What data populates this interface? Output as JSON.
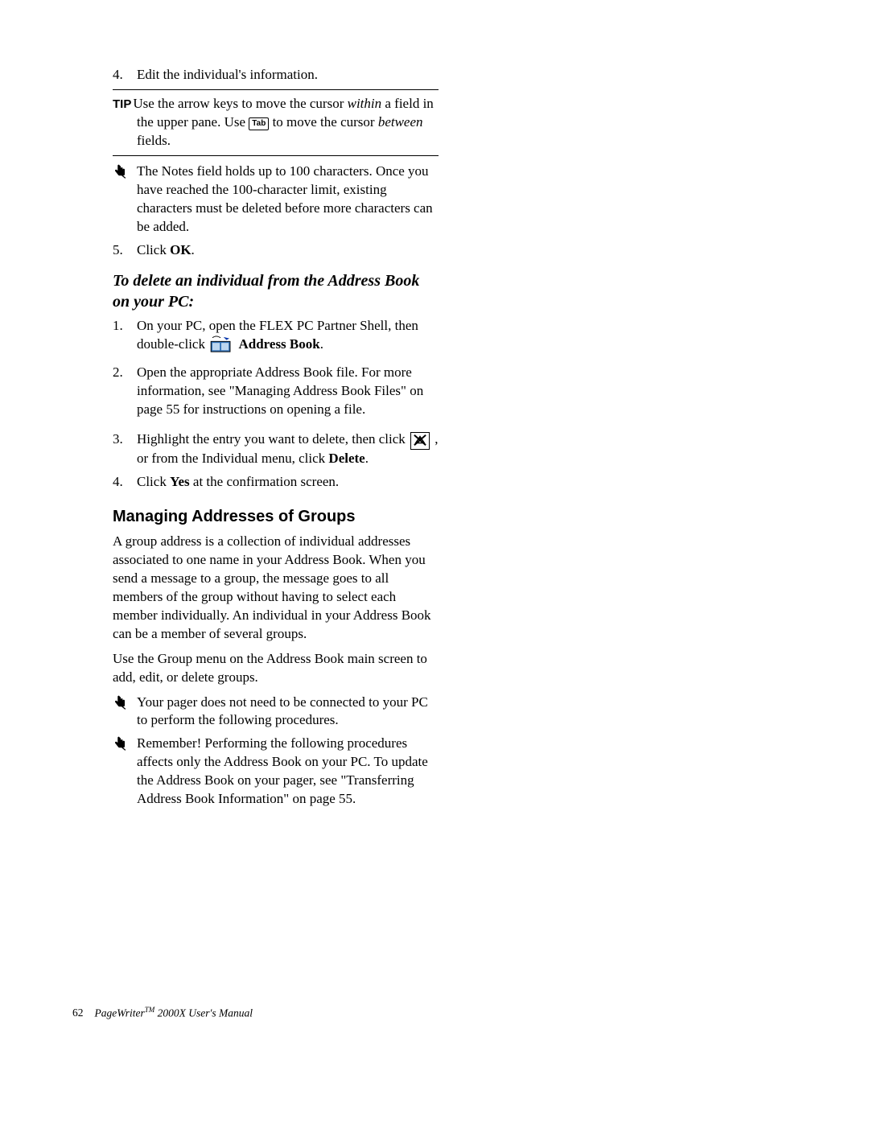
{
  "topList": {
    "item4": {
      "marker": "4.",
      "text": "Edit the individual's information."
    },
    "item5": {
      "marker": "5.",
      "prefix": "Click ",
      "bold": "OK",
      "suffix": "."
    }
  },
  "tip": {
    "label": "TIP",
    "line1_a": "Use the arrow keys to move the cursor ",
    "line1_em": "within",
    "line1_b": " a field in the upper pane. Use ",
    "tabKey": "Tab",
    "line1_c": " to move the cursor ",
    "line1_em2": "between",
    "line1_d": " fields."
  },
  "noteA": "The Notes field holds up to 100 characters. Once you have reached the 100-character limit, existing characters must be deleted before more characters can be added.",
  "subheading": "To delete an individual from the Address Book on your PC:",
  "delList": {
    "i1": {
      "marker": "1.",
      "a": "On your PC, open the FLEX PC Partner Shell, then double-click ",
      "bold": "Address Book",
      "b": "."
    },
    "i2": {
      "marker": "2.",
      "text": "Open the appropriate Address Book file. For more information, see \"Managing Address Book Files\" on page 55 for instructions on opening a file."
    },
    "i3": {
      "marker": "3.",
      "a": "Highlight the entry you want to delete, then click ",
      "b": " , or from the Individual menu, click ",
      "bold": "Delete",
      "c": "."
    },
    "i4": {
      "marker": "4.",
      "a": "Click ",
      "bold": "Yes",
      "b": " at the confirmation screen."
    }
  },
  "h2": "Managing Addresses of Groups",
  "para1": "A group address is a collection of individual addresses associated to one name in your Address Book. When you send a message to a group, the message goes to all members of the group without having to select each member individually. An individual in your Address Book can be a member of several groups.",
  "para2": "Use the Group menu on the Address Book main screen to add, edit, or delete groups.",
  "noteB": "Your pager does not need to be connected to your PC to perform the following procedures.",
  "noteC": "Remember! Performing the following procedures affects only the Address Book on your PC. To update the Address Book on your pager, see \"Transferring Address Book Information\" on page 55.",
  "footer": {
    "pageNum": "62",
    "a": "PageWriter",
    "tm": "TM",
    "b": " 2000X User's Manual"
  }
}
